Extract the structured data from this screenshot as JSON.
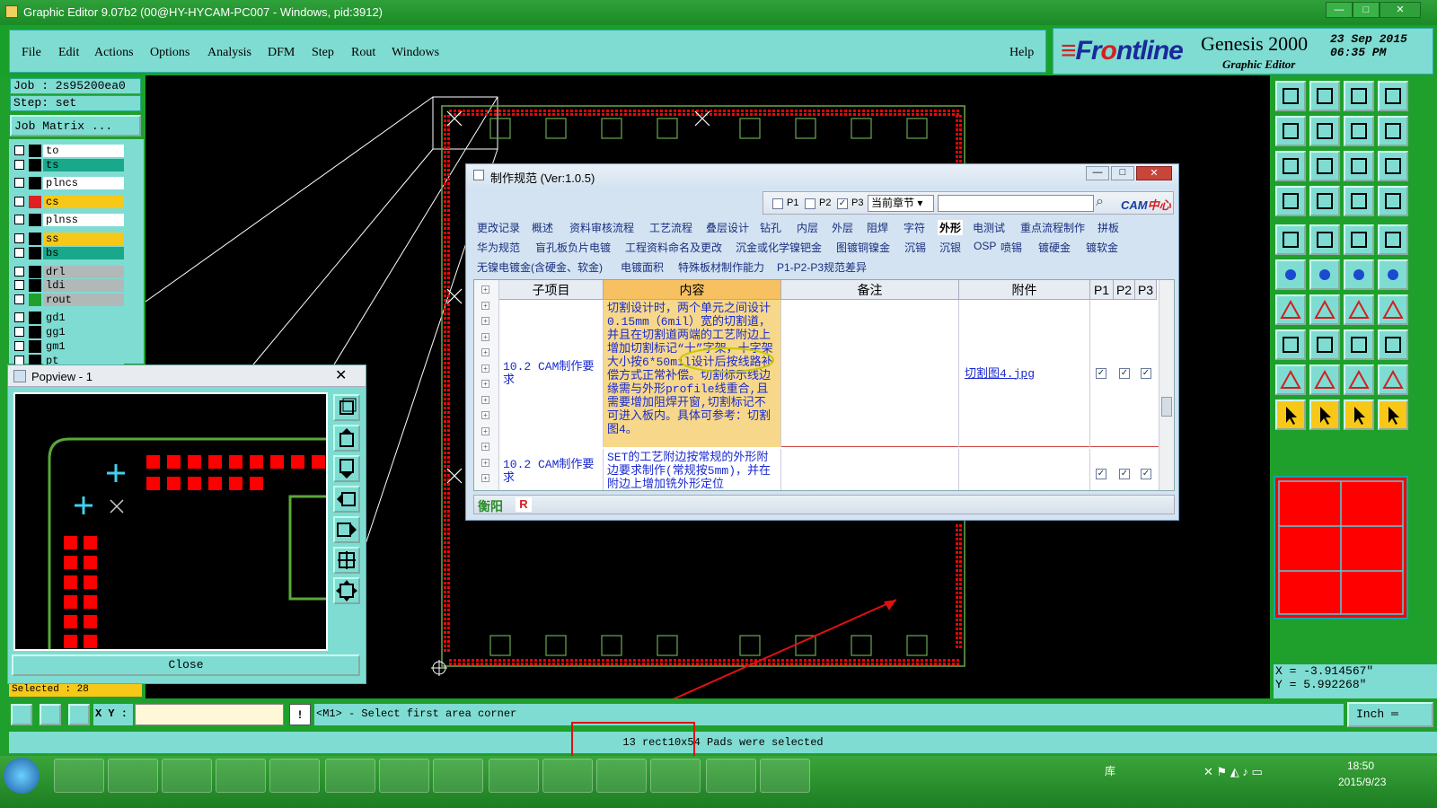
{
  "window": {
    "title": "Graphic Editor 9.07b2 (00@HY-HYCAM-PC007 - Windows, pid:3912)"
  },
  "menubar": {
    "items": [
      "File",
      "Edit",
      "Actions",
      "Options",
      "Analysis",
      "DFM",
      "Step",
      "Rout",
      "Windows"
    ],
    "help": "Help"
  },
  "brand": {
    "logo_a": "Fr",
    "logo_o": "o",
    "logo_b": "ntline",
    "product": "Genesis 2000",
    "subtitle": "Graphic Editor",
    "date": "23 Sep 2015",
    "time": "06:35 PM"
  },
  "job": {
    "job_label": "Job : 2s95200ea0",
    "step_label": "Step: set",
    "matrix_button": "Job Matrix ..."
  },
  "layers": [
    {
      "name": "to",
      "color": "#ffffff",
      "indicator": "#000000"
    },
    {
      "name": "ts",
      "color": "#1aa88a",
      "indicator": "#000000"
    },
    {
      "name": "plncs",
      "color": "#ffffff",
      "indicator": "#000000"
    },
    {
      "name": "cs",
      "color": "#f7c818",
      "indicator": "#e02020"
    },
    {
      "name": "plnss",
      "color": "#ffffff",
      "indicator": "#000000"
    },
    {
      "name": "ss",
      "color": "#f7c818",
      "indicator": "#000000"
    },
    {
      "name": "bs",
      "color": "#1aa88a",
      "indicator": "#000000"
    },
    {
      "name": "drl",
      "color": "#b0b8b8",
      "indicator": "#000000"
    },
    {
      "name": "ldi",
      "color": "#b0b8b8",
      "indicator": "#000000"
    },
    {
      "name": "rout",
      "color": "#b0b8b8",
      "indicator": "#1fa02c"
    },
    {
      "name": "gd1",
      "color": "#7fdcd2",
      "indicator": "#000000"
    },
    {
      "name": "gg1",
      "color": "#7fdcd2",
      "indicator": "#000000"
    },
    {
      "name": "gm1",
      "color": "#7fdcd2",
      "indicator": "#000000"
    },
    {
      "name": "pt",
      "color": "#7fdcd2",
      "indicator": "#000000"
    }
  ],
  "popview": {
    "title": "Popview - 1",
    "close_label": "Close",
    "selected_label": "Selected : 28"
  },
  "spec_dialog": {
    "title": "制作规范 (Ver:1.0.5)",
    "filter_p1": "P1",
    "filter_p2": "P2",
    "filter_p3": "P3",
    "scope": "当前章节",
    "badge_a": "CAM",
    "badge_b": "中心",
    "tabs_row1": [
      "更改记录",
      "概述",
      "资料审核流程",
      "工艺流程",
      "叠层设计",
      "钻孔",
      "内层",
      "外层",
      "阻焊",
      "字符",
      "外形",
      "电测试",
      "重点流程制作",
      "拼板"
    ],
    "tabs_row2": [
      "华为规范",
      "盲孔板负片电镀",
      "工程资料命名及更改",
      "沉金或化学镍钯金",
      "图镀铜镍金",
      "沉锡",
      "沉银",
      "OSP",
      "喷锡",
      "镀硬金",
      "镀软金"
    ],
    "tabs_row3": [
      "无镍电镀金(含硬金、软金)",
      "电镀面积",
      "特殊板材制作能力",
      "P1-P2-P3规范差异"
    ],
    "active_tab": "外形",
    "columns": [
      "子项目",
      "内容",
      "备注",
      "附件",
      "P1",
      "P2",
      "P3"
    ],
    "rows": [
      {
        "sub": "10.2 CAM制作要求",
        "content": "切割设计时，两个单元之间设计0.15mm（6mil）宽的切割道，并且在切割道两端的工艺附边上增加切割标记“十”字架，十字架大小按6*50mil设计后按线路补偿方式正常补偿。切割标示线边缘需与外形profile线重合,且需要增加阻焊开窗,切割标记不可进入板内。具体可参考：切割图4。",
        "remark": "",
        "attach": "切割图4.jpg",
        "p1": "✓",
        "p2": "✓",
        "p3": "✓"
      },
      {
        "sub": "10.2 CAM制作要求",
        "content": "SET的工艺附边按常规的外形附边要求制作(常规按5mm)，并在附边上增加铣外形定位",
        "remark": "",
        "attach": "",
        "p1": "✓",
        "p2": "✓",
        "p3": "✓"
      }
    ],
    "footer_left": "衡阳",
    "footer_badge": "R"
  },
  "coords": {
    "x": "X = -3.914567\"",
    "y": "Y = 5.992268\""
  },
  "command": {
    "xy_label": "X Y :",
    "xy_value": "",
    "prompt": "<M1> - Select first area corner",
    "unit": "Inch"
  },
  "status": {
    "message": "13 rect10x54 Pads were selected"
  },
  "taskbar": {
    "tray_label": "库",
    "time": "18:50",
    "date": "2015/9/23"
  },
  "colors": {
    "app_green": "#1fa02c",
    "panel_cyan": "#7fdcd2",
    "pad_red": "#ff0000",
    "profile_green": "#6aa84f"
  }
}
